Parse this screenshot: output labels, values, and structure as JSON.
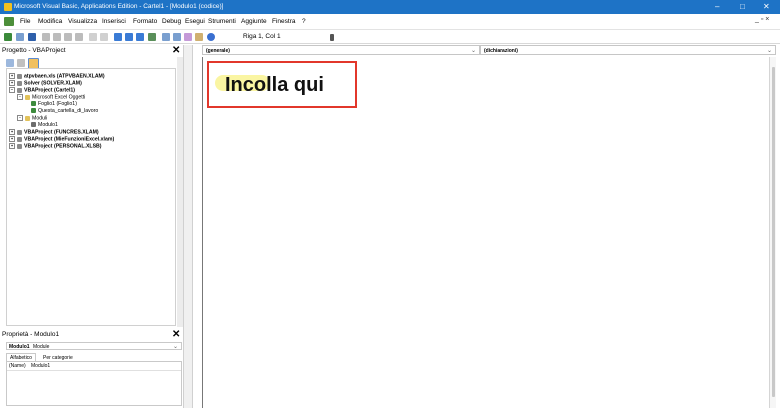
{
  "window": {
    "title": "Microsoft Visual Basic, Applications Edition - Cartel1 - [Modulo1 (codice)]",
    "controls": {
      "minimize": "–",
      "maximize": "□",
      "close": "✕"
    }
  },
  "menu": {
    "items": [
      "File",
      "Modifica",
      "Visualizza",
      "Inserisci",
      "Formato",
      "Debug",
      "Esegui",
      "Strumenti",
      "Aggiunte",
      "Finestra",
      "?"
    ],
    "mdi_controls": "_ ▫ ×"
  },
  "toolbar": {
    "position": "Riga 1, Col 1"
  },
  "project_explorer": {
    "title": "Progetto - VBAProject",
    "close": "✕",
    "tree": [
      {
        "label": "atpvbaen.xls (ATPVBAEN.XLAM)",
        "level": 0
      },
      {
        "label": "Solver (SOLVER.XLAM)",
        "level": 0
      },
      {
        "label": "VBAProject (Cartel1)",
        "level": 0
      },
      {
        "label": "Microsoft Excel Oggetti",
        "level": 1
      },
      {
        "label": "Foglio1 (Foglio1)",
        "level": 2
      },
      {
        "label": "Questa_cartella_di_lavoro",
        "level": 2
      },
      {
        "label": "Moduli",
        "level": 1
      },
      {
        "label": "Modulo1",
        "level": 2
      },
      {
        "label": "VBAProject (FUNCRES.XLAM)",
        "level": 0
      },
      {
        "label": "VBAProject (MieFunzioniExcel.xlam)",
        "level": 0
      },
      {
        "label": "VBAProject (PERSONAL.XLSB)",
        "level": 0
      }
    ]
  },
  "properties": {
    "title": "Proprietà - Modulo1",
    "close": "✕",
    "object_name": "Modulo1",
    "object_type": "Module",
    "tabs": [
      "Alfabetico",
      "Per categorie"
    ],
    "rows": [
      {
        "name": "(Name)",
        "value": "Modulo1"
      }
    ]
  },
  "code": {
    "object_combo": "(generale)",
    "procedure_combo": "(dichiarazioni)"
  },
  "callout": {
    "text": "Incolla qui"
  }
}
